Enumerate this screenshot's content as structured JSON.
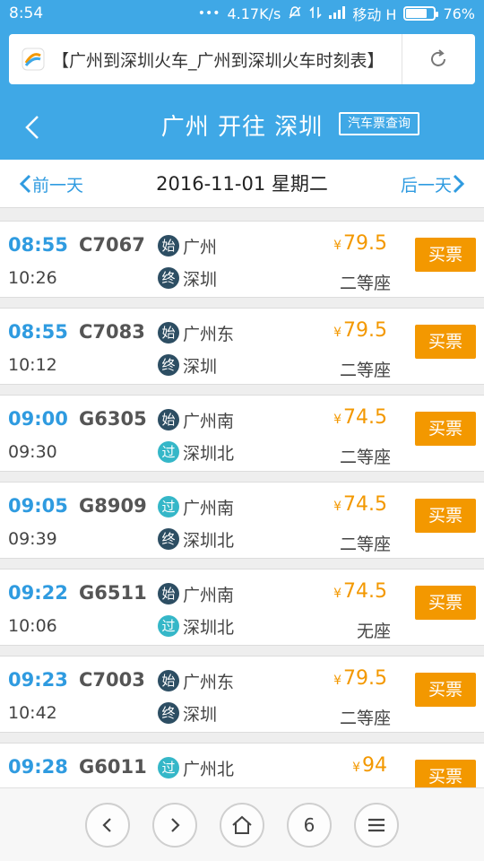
{
  "status_bar": {
    "time": "8:54",
    "speed": "4.17K/s",
    "carrier": "移动 H",
    "battery": "76%",
    "battery_level": 0.76
  },
  "address_bar": {
    "url_text": "【广州到深圳火车_广州到深圳火车时刻表】",
    "site_icon": "site-logo-icon",
    "reload_icon": "reload-icon"
  },
  "header": {
    "title": "广州 开往 深圳",
    "bus_link": "汽车票查询"
  },
  "date_bar": {
    "prev": "前一天",
    "date": "2016-11-01 星期二",
    "next": "后一天"
  },
  "colors": {
    "accent": "#3fa8e6",
    "link": "#2f9be0",
    "price": "#f39800",
    "badge_dark": "#2d4e63",
    "badge_pass": "#35b7c8"
  },
  "trains": [
    {
      "dep": "08:55",
      "arr": "10:26",
      "num": "C7067",
      "from_badge": "始",
      "from": "广州",
      "to_badge": "终",
      "to": "深圳",
      "price_symbol": "¥",
      "price": "79.5",
      "seat": "二等座",
      "buy": "买票"
    },
    {
      "dep": "08:55",
      "arr": "10:12",
      "num": "C7083",
      "from_badge": "始",
      "from": "广州东",
      "to_badge": "终",
      "to": "深圳",
      "price_symbol": "¥",
      "price": "79.5",
      "seat": "二等座",
      "buy": "买票"
    },
    {
      "dep": "09:00",
      "arr": "09:30",
      "num": "G6305",
      "from_badge": "始",
      "from": "广州南",
      "to_badge": "过",
      "to": "深圳北",
      "price_symbol": "¥",
      "price": "74.5",
      "seat": "二等座",
      "buy": "买票"
    },
    {
      "dep": "09:05",
      "arr": "09:39",
      "num": "G8909",
      "from_badge": "过",
      "from": "广州南",
      "to_badge": "终",
      "to": "深圳北",
      "price_symbol": "¥",
      "price": "74.5",
      "seat": "二等座",
      "buy": "买票"
    },
    {
      "dep": "09:22",
      "arr": "10:06",
      "num": "G6511",
      "from_badge": "始",
      "from": "广州南",
      "to_badge": "过",
      "to": "深圳北",
      "price_symbol": "¥",
      "price": "74.5",
      "seat": "无座",
      "buy": "买票"
    },
    {
      "dep": "09:23",
      "arr": "10:42",
      "num": "C7003",
      "from_badge": "始",
      "from": "广州东",
      "to_badge": "终",
      "to": "深圳",
      "price_symbol": "¥",
      "price": "79.5",
      "seat": "二等座",
      "buy": "买票"
    },
    {
      "dep": "09:28",
      "arr": "",
      "num": "G6011",
      "from_badge": "过",
      "from": "广州北",
      "to_badge": "",
      "to": "",
      "price_symbol": "¥",
      "price": "94",
      "seat": "",
      "buy": "买票"
    }
  ],
  "bottom_nav": {
    "back_icon": "chevron-left-icon",
    "forward_icon": "chevron-right-icon",
    "home_icon": "home-icon",
    "tabs_count": "6",
    "menu_icon": "menu-icon"
  }
}
